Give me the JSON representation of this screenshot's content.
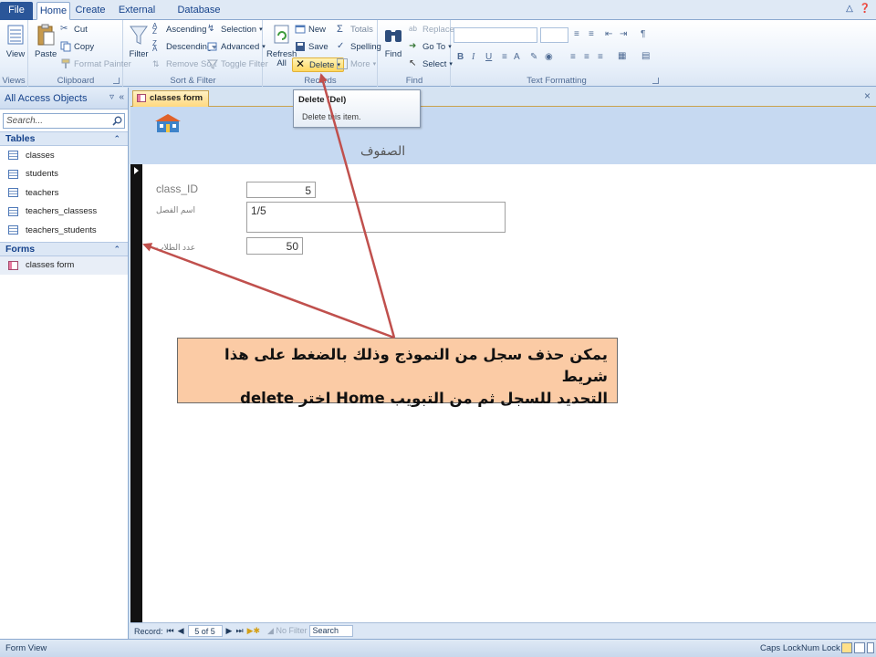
{
  "ribbon_tabs": [
    "File",
    "Home",
    "Create",
    "External Data",
    "Database Tools"
  ],
  "groups": {
    "views": {
      "label": "Views",
      "view": "View"
    },
    "clipboard": {
      "label": "Clipboard",
      "paste": "Paste",
      "cut": "Cut",
      "copy": "Copy",
      "format_painter": "Format Painter"
    },
    "sort_filter": {
      "label": "Sort & Filter",
      "filter": "Filter",
      "ascending": "Ascending",
      "descending": "Descending",
      "remove_sort": "Remove Sort",
      "selection": "Selection",
      "advanced": "Advanced",
      "toggle_filter": "Toggle Filter"
    },
    "records": {
      "label": "Records",
      "refresh": "Refresh",
      "refresh_sub": "All",
      "new": "New",
      "save": "Save",
      "delete": "Delete",
      "totals": "Totals",
      "spelling": "Spelling",
      "more": "More"
    },
    "find": {
      "label": "Find",
      "find": "Find",
      "replace": "Replace",
      "goto": "Go To",
      "select": "Select"
    },
    "text_formatting": {
      "label": "Text Formatting"
    }
  },
  "tooltip": {
    "title": "Delete (Del)",
    "description": "Delete this item."
  },
  "nav": {
    "title": "All Access Objects",
    "search_placeholder": "Search...",
    "tables_header": "Tables",
    "tables": [
      "classes",
      "students",
      "teachers",
      "teachers_classess",
      "teachers_students"
    ],
    "forms_header": "Forms",
    "forms": [
      "classes form"
    ]
  },
  "document": {
    "tab": "classes form",
    "header_title": "الصفوف",
    "fields": [
      {
        "label": "class_ID",
        "value": "5"
      },
      {
        "label": "اسم الفصل",
        "value": "1/5"
      },
      {
        "label": "عدد الطلاب",
        "value": "50"
      }
    ]
  },
  "record_nav": {
    "label": "Record:",
    "position": "5 of 5",
    "filter": "No Filter",
    "search": "Search"
  },
  "status": {
    "view": "Form View",
    "caps_lock": "Caps Lock",
    "num_lock": "Num Lock"
  },
  "callout": {
    "line1": "يمكن حذف سجل من النموذج وذلك بالضغط على هذا شريط",
    "line2": "التحديد للسجل ثم من التبويب Home اختر delete"
  },
  "colors": {
    "file_tab": "#2a5699",
    "form_header": "#c6d9f1",
    "callout_bg": "#fbcba5",
    "arrow": "#c0504d",
    "selector_bar": "#121212"
  }
}
